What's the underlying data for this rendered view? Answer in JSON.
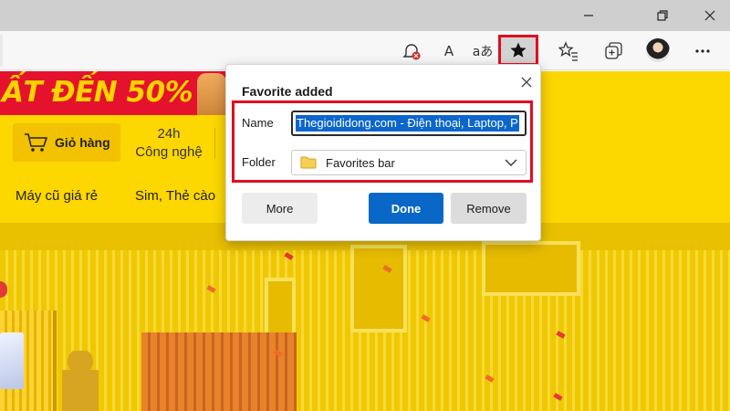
{
  "toolbar": {
    "read_aloud_icon_text": "A",
    "translate_icon_text": "aあ"
  },
  "page": {
    "promo_text": "ẤT ĐẾN 50%",
    "cart_label": "Giỏ hàng",
    "nav_24h_line1": "24h",
    "nav_24h_line2": "Công nghệ",
    "nav_links": [
      "Máy cũ giá rẻ",
      "Sim, Thẻ cào"
    ],
    "accent_color": "#fdd700"
  },
  "popup": {
    "title": "Favorite added",
    "name_label": "Name",
    "name_value": "Thegioididong.com - Điện thoại, Laptop, P",
    "folder_label": "Folder",
    "folder_value": "Favorites bar",
    "buttons": {
      "more": "More",
      "done": "Done",
      "remove": "Remove"
    },
    "highlight_color": "#e10d1f",
    "done_color": "#0967c7"
  }
}
